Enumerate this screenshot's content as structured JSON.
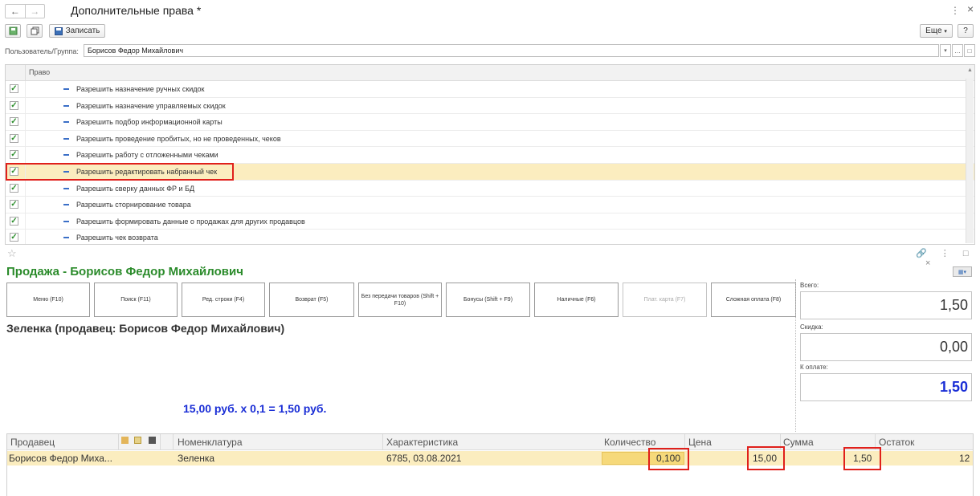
{
  "window": {
    "title": "Дополнительные права *",
    "back_icon": "arrow-left-icon",
    "forward_icon": "arrow-right-icon"
  },
  "toolbar": {
    "save_label": "Записать",
    "more_label": "Еще",
    "help_label": "?"
  },
  "user_field": {
    "label": "Пользователь/Группа:",
    "value": "Борисов Федор Михайлович"
  },
  "rights": {
    "column_header": "Право",
    "items": [
      {
        "label": "Разрешить назначение ручных скидок",
        "checked": true
      },
      {
        "label": "Разрешить назначение управляемых скидок",
        "checked": true
      },
      {
        "label": "Разрешить подбор информационной карты",
        "checked": true
      },
      {
        "label": "Разрешить проведение пробитых, но не проведенных, чеков",
        "checked": true
      },
      {
        "label": "Разрешить работу с отложенными чеками",
        "checked": true
      },
      {
        "label": "Разрешить редактировать набранный чек",
        "checked": true,
        "selected": true
      },
      {
        "label": "Разрешить сверку данных ФР и БД",
        "checked": true
      },
      {
        "label": "Разрешить сторнирование товара",
        "checked": true
      },
      {
        "label": "Разрешить формировать данные о продажах для других продавцов",
        "checked": true
      },
      {
        "label": "Разрешить чек возврата",
        "checked": true
      }
    ]
  },
  "sale": {
    "title": "Продажа - Борисов Федор Михайлович",
    "buttons": [
      "Меню (F10)",
      "Поиск (F11)",
      "Ред. строки (F4)",
      "Возврат (F5)",
      "Без передачи товаров (Shift + F10)",
      "Бонусы (Shift + F9)",
      "Наличные (F6)",
      "Плат. карта (F7)",
      "Сложная оплата (F8)"
    ],
    "seller_line": "Зеленка (продавец: Борисов Федор Михайлович)",
    "calc_line": "15,00 руб. x 0,1  = 1,50 руб.",
    "totals": {
      "total_label": "Всего:",
      "total_value": "1,50",
      "discount_label": "Скидка:",
      "discount_value": "0,00",
      "pay_label": "К оплате:",
      "pay_value": "1,50"
    }
  },
  "items_table": {
    "headers": {
      "seller": "Продавец",
      "nomenclature": "Номенклатура",
      "characteristic": "Характеристика",
      "quantity": "Количество",
      "price": "Цена",
      "sum": "Сумма",
      "remainder": "Остаток"
    },
    "row": {
      "seller": "Борисов Федор Миха...",
      "nomenclature": "Зеленка",
      "characteristic": "6785, 03.08.2021",
      "quantity": "0,100",
      "price": "15,00",
      "sum": "1,50",
      "remainder": "12"
    }
  },
  "colors": {
    "accent_green": "#2b8b2b",
    "highlight_row": "#fbedbf",
    "annotation_red": "#e0201b",
    "amount_blue": "#1a2ed6"
  }
}
